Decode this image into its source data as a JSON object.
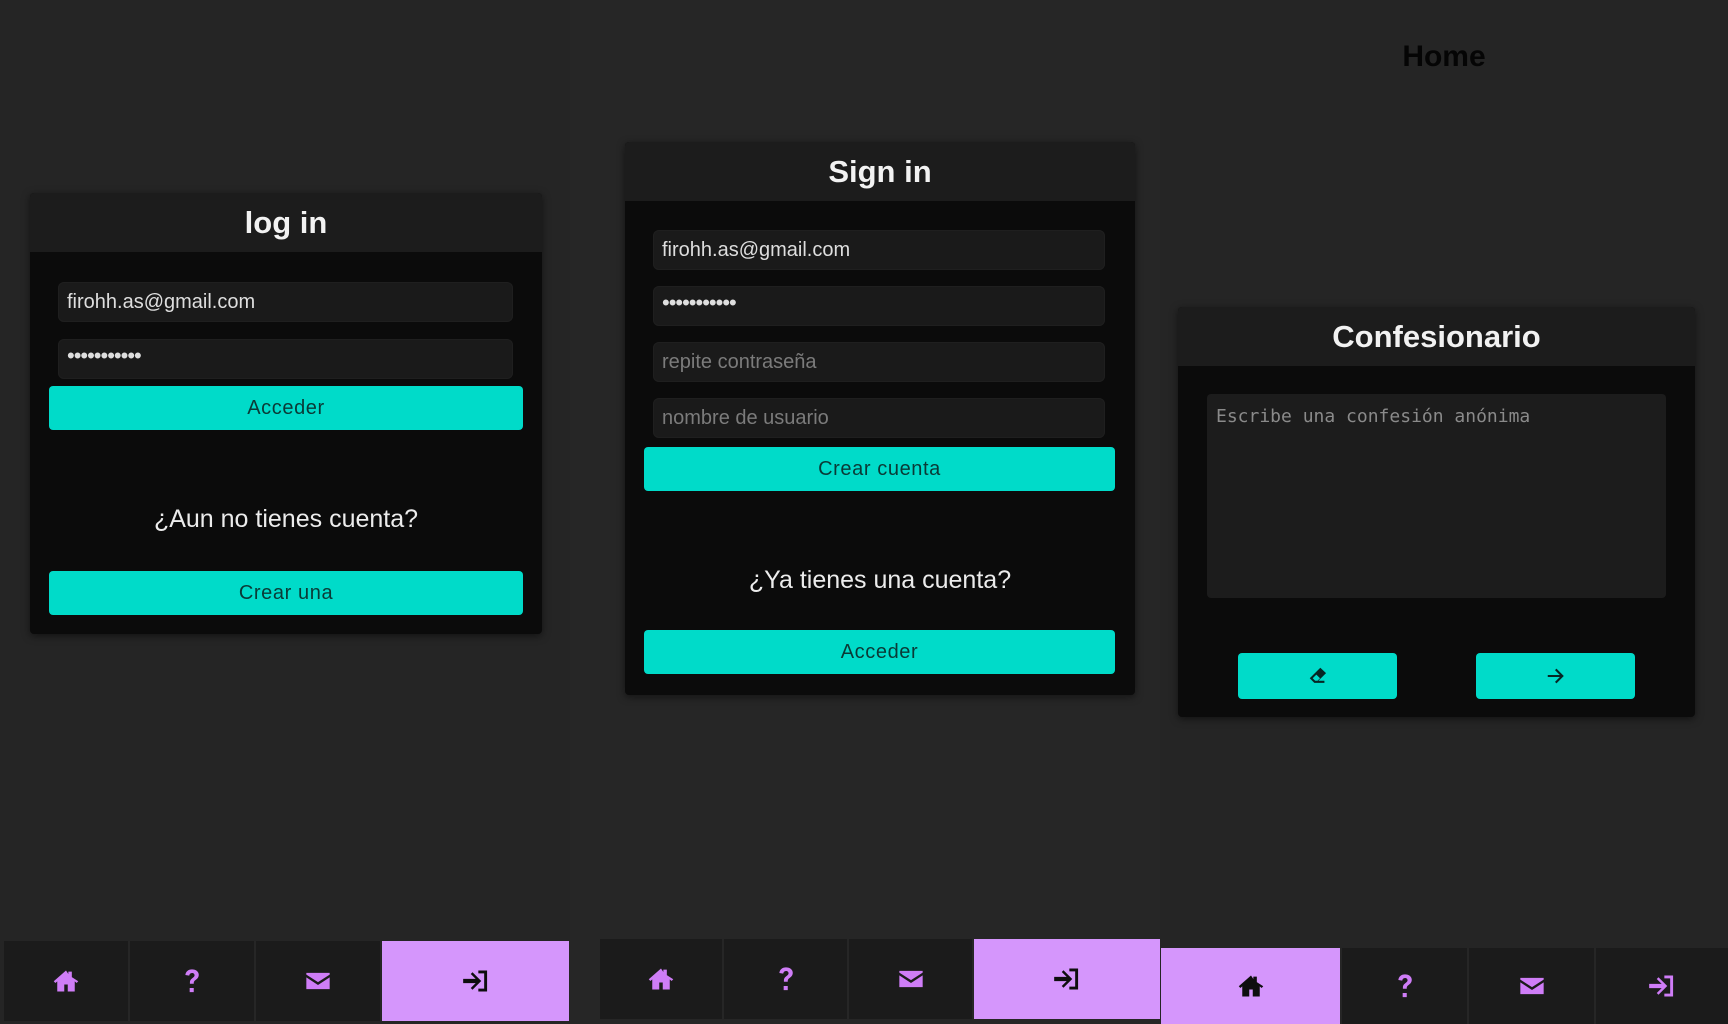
{
  "login": {
    "title": "log in",
    "email_value": "firohh.as@gmail.com",
    "password_value": "•••••••••••",
    "submit_label": "Acceder",
    "question": "¿Aun no tienes cuenta?",
    "alt_label": "Crear una"
  },
  "signin": {
    "title": "Sign in",
    "email_value": "firohh.as@gmail.com",
    "password_value": "•••••••••••",
    "repeat_placeholder": "repite contraseña",
    "username_placeholder": "nombre de usuario",
    "submit_label": "Crear cuenta",
    "question": "¿Ya tienes una cuenta?",
    "alt_label": "Acceder"
  },
  "home": {
    "page_title": "Home",
    "card_title": "Confesionario",
    "textarea_placeholder": "Escribe una confesión anónima",
    "clear_icon": "eraser-icon",
    "send_icon": "arrow-right-icon"
  },
  "navbar": {
    "items": [
      "home-icon",
      "question-icon",
      "envelope-icon",
      "sign-in-icon"
    ],
    "icon_color": "#cf7df7",
    "active_color": "#d596fc"
  },
  "colors": {
    "accent": "#00dbc9",
    "background": "#252525",
    "card": "#0b0b0b"
  }
}
